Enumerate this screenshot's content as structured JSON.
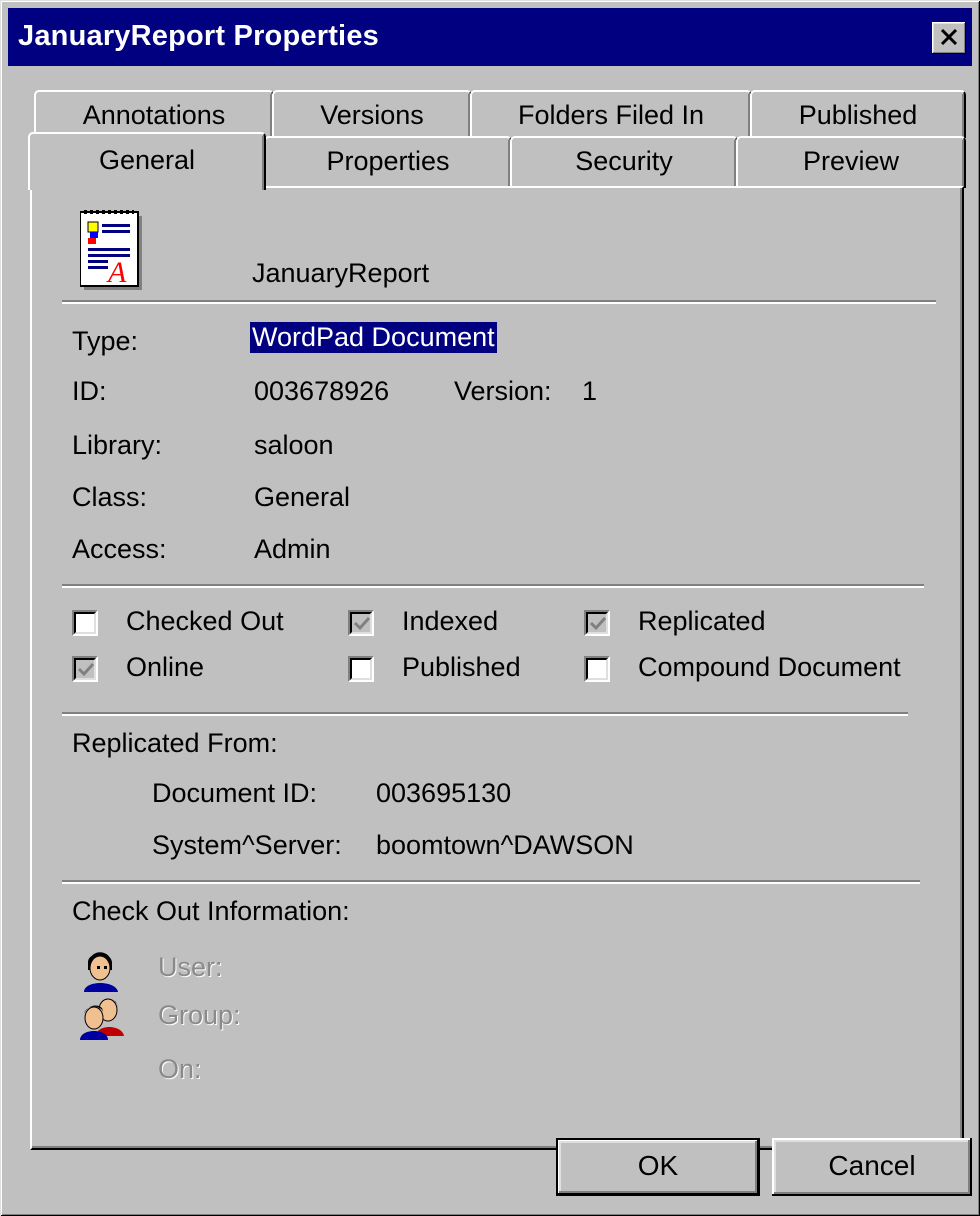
{
  "window": {
    "title": "JanuaryReport Properties"
  },
  "tabs_row1": [
    {
      "label": "Annotations"
    },
    {
      "label": "Versions"
    },
    {
      "label": "Folders Filed In"
    },
    {
      "label": "Published"
    }
  ],
  "tabs_row2": [
    {
      "label": "General",
      "active": true
    },
    {
      "label": "Properties"
    },
    {
      "label": "Security"
    },
    {
      "label": "Preview"
    }
  ],
  "document": {
    "icon": "wordpad-document-icon",
    "name": "JanuaryReport",
    "type_label": "Type:",
    "type_value": "WordPad Document",
    "id_label": "ID:",
    "id_value": "003678926",
    "version_label": "Version:",
    "version_value": "1",
    "library_label": "Library:",
    "library_value": "saloon",
    "class_label": "Class:",
    "class_value": "General",
    "access_label": "Access:",
    "access_value": "Admin"
  },
  "flags": {
    "checked_out": {
      "label": "Checked Out",
      "checked": false
    },
    "indexed": {
      "label": "Indexed",
      "checked": true
    },
    "replicated": {
      "label": "Replicated",
      "checked": true
    },
    "online": {
      "label": "Online",
      "checked": true
    },
    "published": {
      "label": "Published",
      "checked": false
    },
    "compound": {
      "label": "Compound Document",
      "checked": false
    }
  },
  "replicated_from": {
    "heading": "Replicated From:",
    "doc_id_label": "Document ID:",
    "doc_id_value": "003695130",
    "server_label": "System^Server:",
    "server_value": "boomtown^DAWSON"
  },
  "checkout": {
    "heading": "Check Out Information:",
    "user_label": "User:",
    "group_label": "Group:",
    "on_label": "On:",
    "user_icon": "user-icon",
    "group_icon": "group-icon"
  },
  "buttons": {
    "ok": "OK",
    "cancel": "Cancel"
  },
  "colors": {
    "titlebar": "#000080",
    "face": "#c0c0c0",
    "highlight": "#000080"
  }
}
